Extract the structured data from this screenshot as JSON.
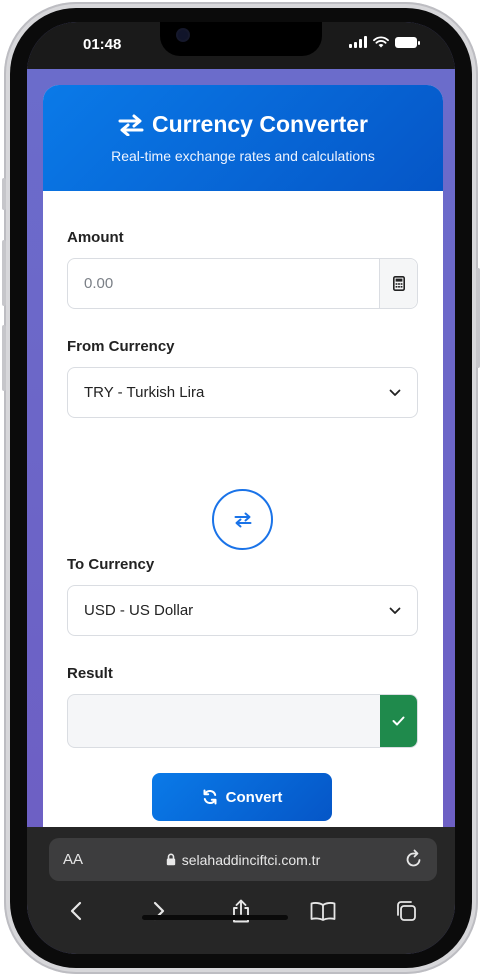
{
  "status_bar": {
    "time": "01:48"
  },
  "header": {
    "title": "Currency Converter",
    "subtitle": "Real-time exchange rates and calculations",
    "icon": "exchange-arrows-icon"
  },
  "amount": {
    "label": "Amount",
    "placeholder": "0.00",
    "value": "",
    "addon_icon": "calculator-icon"
  },
  "from_currency": {
    "label": "From Currency",
    "selected": "TRY - Turkish Lira"
  },
  "swap": {
    "icon": "swap-arrows-icon"
  },
  "to_currency": {
    "label": "To Currency",
    "selected": "USD - US Dollar"
  },
  "result": {
    "label": "Result",
    "value": "",
    "addon_icon": "check-icon"
  },
  "convert": {
    "label": "Convert",
    "icon": "sync-icon"
  },
  "browser": {
    "aa_label": "AA",
    "url": "selahaddinciftci.com.tr",
    "nav_icons": [
      "back-icon",
      "forward-icon",
      "share-icon",
      "bookmarks-icon",
      "tabs-icon"
    ]
  },
  "colors": {
    "primary": "#0a7ae8",
    "primary_dark": "#0556c7",
    "success": "#1f8a4c",
    "page_bg": "#6b6ccb",
    "browser_bar": "#262626"
  }
}
